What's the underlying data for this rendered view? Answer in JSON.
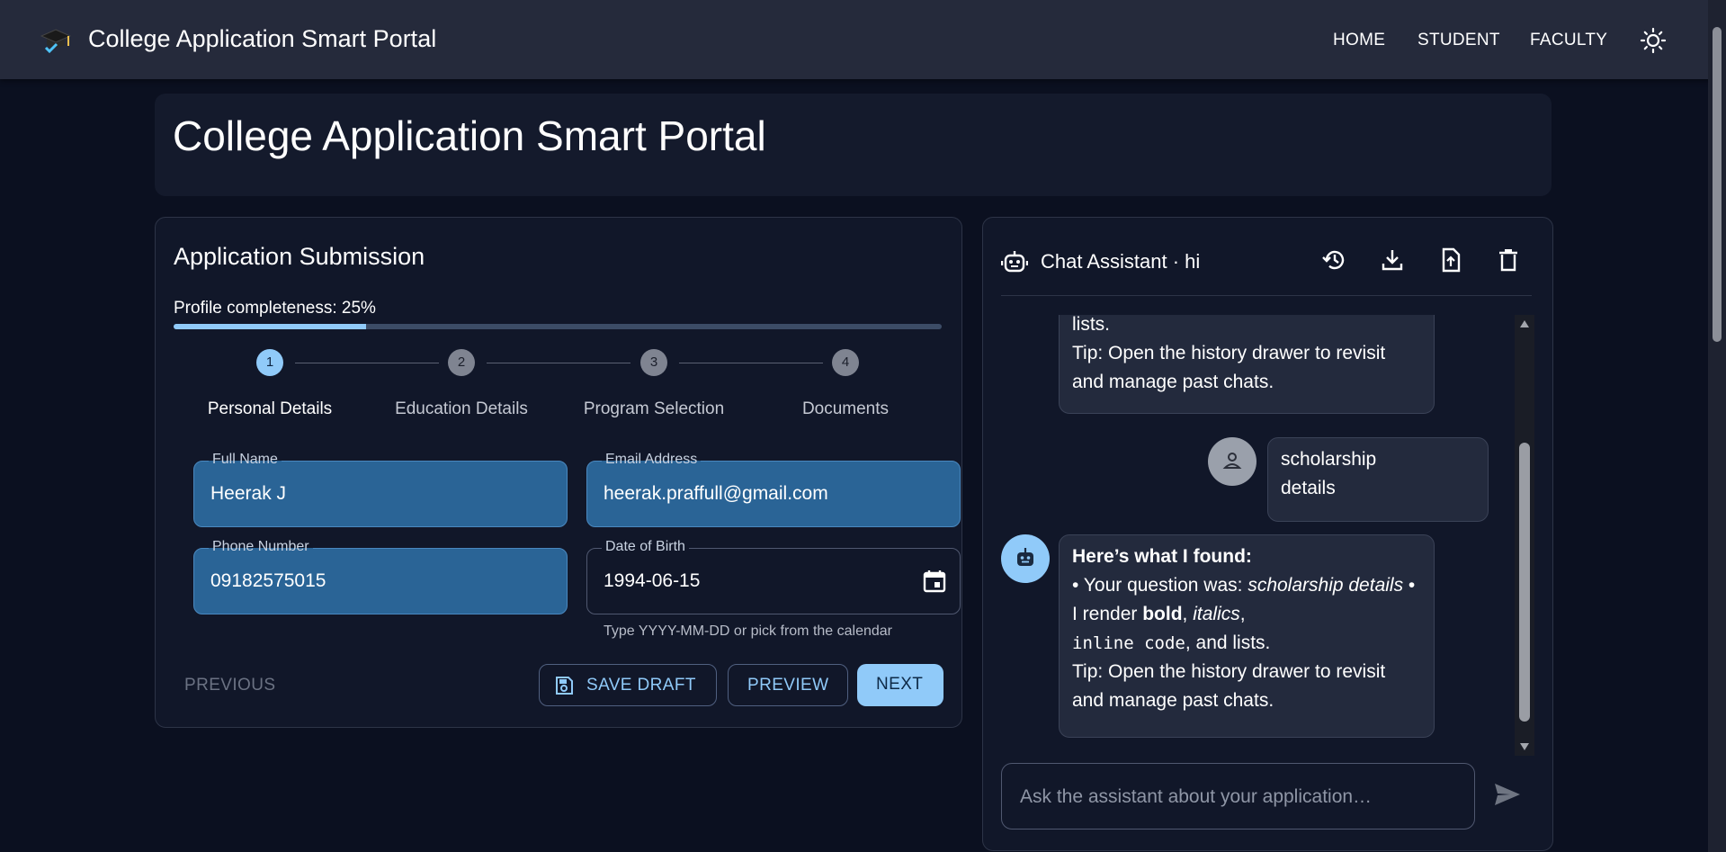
{
  "app": {
    "title": "College Application Smart Portal",
    "nav": [
      "HOME",
      "STUDENT",
      "FACULTY"
    ],
    "theme_icon": "sun-icon"
  },
  "page": {
    "title": "College Application Smart Portal"
  },
  "form": {
    "title": "Application Submission",
    "progress_label": "Profile completeness: 25%",
    "progress_value": 0.25,
    "steps": [
      {
        "number": "1",
        "label": "Personal Details",
        "active": true
      },
      {
        "number": "2",
        "label": "Education Details",
        "active": false
      },
      {
        "number": "3",
        "label": "Program Selection",
        "active": false
      },
      {
        "number": "4",
        "label": "Documents",
        "active": false
      }
    ],
    "fields": {
      "full_name": {
        "label": "Full Name",
        "value": "Heerak J"
      },
      "email": {
        "label": "Email Address",
        "value": "heerak.praffull@gmail.com"
      },
      "phone": {
        "label": "Phone Number",
        "value": "09182575015"
      },
      "dob": {
        "label": "Date of Birth",
        "value": "1994-06-15",
        "helper": "Type YYYY-MM-DD or pick from the calendar"
      }
    },
    "buttons": {
      "previous": "PREVIOUS",
      "save_draft": "SAVE DRAFT",
      "preview": "PREVIEW",
      "next": "NEXT"
    }
  },
  "chat": {
    "title": "Chat Assistant · hi",
    "header_icons": [
      "history-icon",
      "download-icon",
      "upload-file-icon",
      "delete-icon"
    ],
    "messages": [
      {
        "role": "assistant",
        "partial_line": "lists.",
        "tip": "Tip: Open the history drawer to revisit and manage past chats."
      },
      {
        "role": "user",
        "text": "scholarship details"
      },
      {
        "role": "assistant",
        "heading": "Here’s what I found:",
        "q_prefix": "• Your question was: ",
        "q_text": "scholarship details",
        "r_prefix": " • I render ",
        "bold": "bold",
        "sep1": ", ",
        "italics": "italics",
        "sep2": ",",
        "code": "inline code",
        "r_suffix": ", and lists.",
        "tip": "Tip: Open the history drawer to revisit and manage past chats."
      }
    ],
    "input_placeholder": "Ask the assistant about your application…"
  },
  "colors": {
    "accent": "#90caf9",
    "filled_field": "#2a6496",
    "background": "#0b1020",
    "appbar": "#252a3b"
  }
}
